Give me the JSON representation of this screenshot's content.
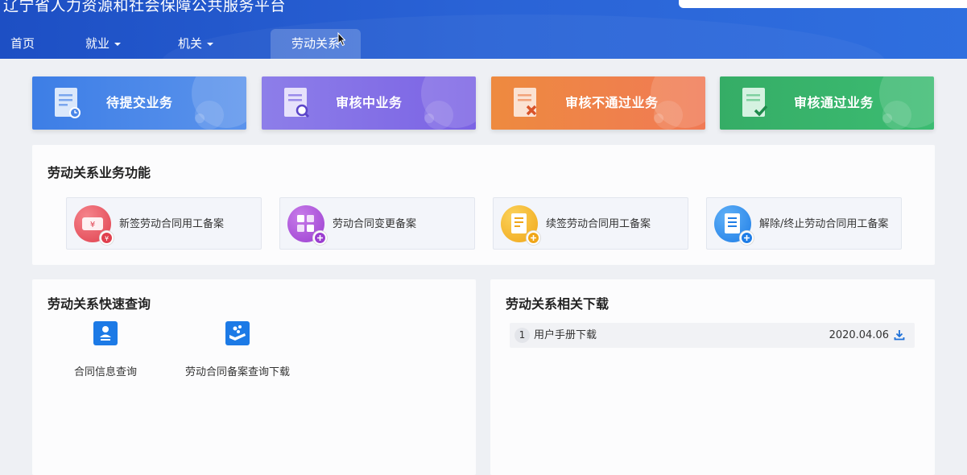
{
  "header": {
    "site_title": "辽宁省人力资源和社会保障公共服务平台",
    "nav": [
      {
        "label": "首页",
        "dropdown": false
      },
      {
        "label": "就业",
        "dropdown": true
      },
      {
        "label": "机关",
        "dropdown": true
      },
      {
        "label": "劳动关系",
        "dropdown": false,
        "active": true
      }
    ]
  },
  "status_cards": [
    {
      "label": "待提交业务",
      "color": "#4a86e8"
    },
    {
      "label": "审核中业务",
      "color": "#8a72e8"
    },
    {
      "label": "审核不通过业务",
      "color": "#f08a4b"
    },
    {
      "label": "审核通过业务",
      "color": "#35b36a"
    }
  ],
  "functions": {
    "title": "劳动关系业务功能",
    "items": [
      {
        "label": "新签劳动合同用工备案",
        "icon": "contract-new-icon",
        "color": "#e8505b"
      },
      {
        "label": "劳动合同变更备案",
        "icon": "contract-change-icon",
        "color": "#a64fd6"
      },
      {
        "label": "续签劳动合同用工备案",
        "icon": "contract-renew-icon",
        "color": "#f5b72a"
      },
      {
        "label": "解除/终止劳动合同用工备案",
        "icon": "contract-terminate-icon",
        "color": "#2d8ef0"
      }
    ]
  },
  "quick_query": {
    "title": "劳动关系快速查询",
    "items": [
      {
        "label": "合同信息查询",
        "icon": "contract-info-icon"
      },
      {
        "label": "劳动合同备案查询下载",
        "icon": "hand-coins-icon"
      }
    ]
  },
  "downloads": {
    "title": "劳动关系相关下载",
    "items": [
      {
        "index": "1",
        "name": "用户手册下载",
        "date": "2020.04.06",
        "icon": "download-icon"
      }
    ]
  }
}
